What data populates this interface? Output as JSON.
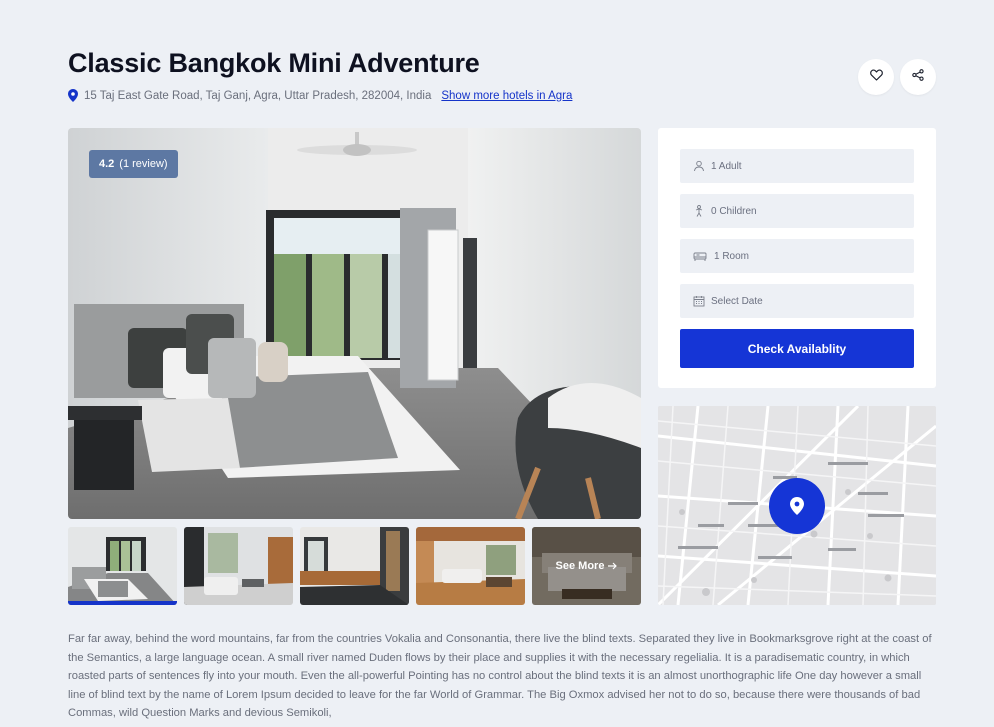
{
  "header": {
    "title": "Classic Bangkok Mini Adventure",
    "address": "15 Taj East Gate Road, Taj Ganj, Agra, Uttar Pradesh, 282004, India",
    "more_link": "Show more hotels in Agra"
  },
  "actions": {
    "favorite_icon": "heart-icon",
    "share_icon": "share-icon"
  },
  "gallery": {
    "rating_value": "4.2",
    "rating_reviews": "(1 review)",
    "see_more": "See More"
  },
  "booking": {
    "adults": "1 Adult",
    "children": "0 Children",
    "rooms": "1 Room",
    "date_placeholder": "Select Date",
    "check_label": "Check Availablity"
  },
  "colors": {
    "accent": "#1535d6",
    "rating_bg": "#5d78a3",
    "page_bg": "#edf0f5"
  },
  "description": "Far far away, behind the word mountains, far from the countries Vokalia and Consonantia, there live the blind texts. Separated they live in Bookmarksgrove right at the coast of the Semantics, a large language ocean. A small river named Duden flows by their place and supplies it with the necessary regelialia. It is a paradisematic country, in which roasted parts of sentences fly into your mouth. Even the all-powerful Pointing has no control about the blind texts it is an almost unorthographic life One day however a small line of blind text by the name of Lorem Ipsum decided to leave for the far World of Grammar. The Big Oxmox advised her not to do so, because there were thousands of bad Commas, wild Question Marks and devious Semikoli,"
}
